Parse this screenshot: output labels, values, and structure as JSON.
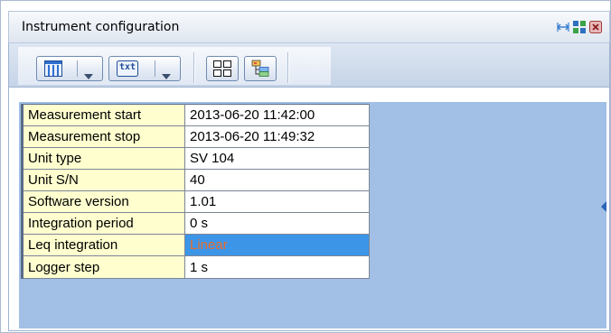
{
  "window": {
    "title": "Instrument configuration"
  },
  "title_controls": {
    "restore": "restore-icon",
    "maximize": "maximize-icon",
    "close": "close-icon"
  },
  "toolbar": {
    "buttons": [
      {
        "name": "columns-view-button",
        "icon": "columns-icon",
        "has_dropdown": true
      },
      {
        "name": "text-export-button",
        "label": "txt",
        "icon": "txt-icon",
        "has_dropdown": true
      },
      {
        "name": "grid-layout-button",
        "icon": "grid-icon",
        "has_dropdown": false
      },
      {
        "name": "tree-view-button",
        "icon": "tree-icon",
        "has_dropdown": false
      }
    ]
  },
  "properties": [
    {
      "key": "Measurement start",
      "value": "2013-06-20 11:42:00"
    },
    {
      "key": "Measurement stop",
      "value": "2013-06-20 11:49:32"
    },
    {
      "key": "Unit type",
      "value": "SV 104"
    },
    {
      "key": "Unit S/N",
      "value": "40"
    },
    {
      "key": "Software version",
      "value": "1.01"
    },
    {
      "key": "Integration period",
      "value": "0 s"
    },
    {
      "key": "Leq integration",
      "value": "Linear",
      "selected": true
    },
    {
      "key": "Logger step",
      "value": "1 s"
    }
  ],
  "colors": {
    "panel_background": "#a2bfe5",
    "key_cell": "#fefecf",
    "selected_cell": "#3d95e8",
    "selected_text": "#ea6d2a"
  }
}
